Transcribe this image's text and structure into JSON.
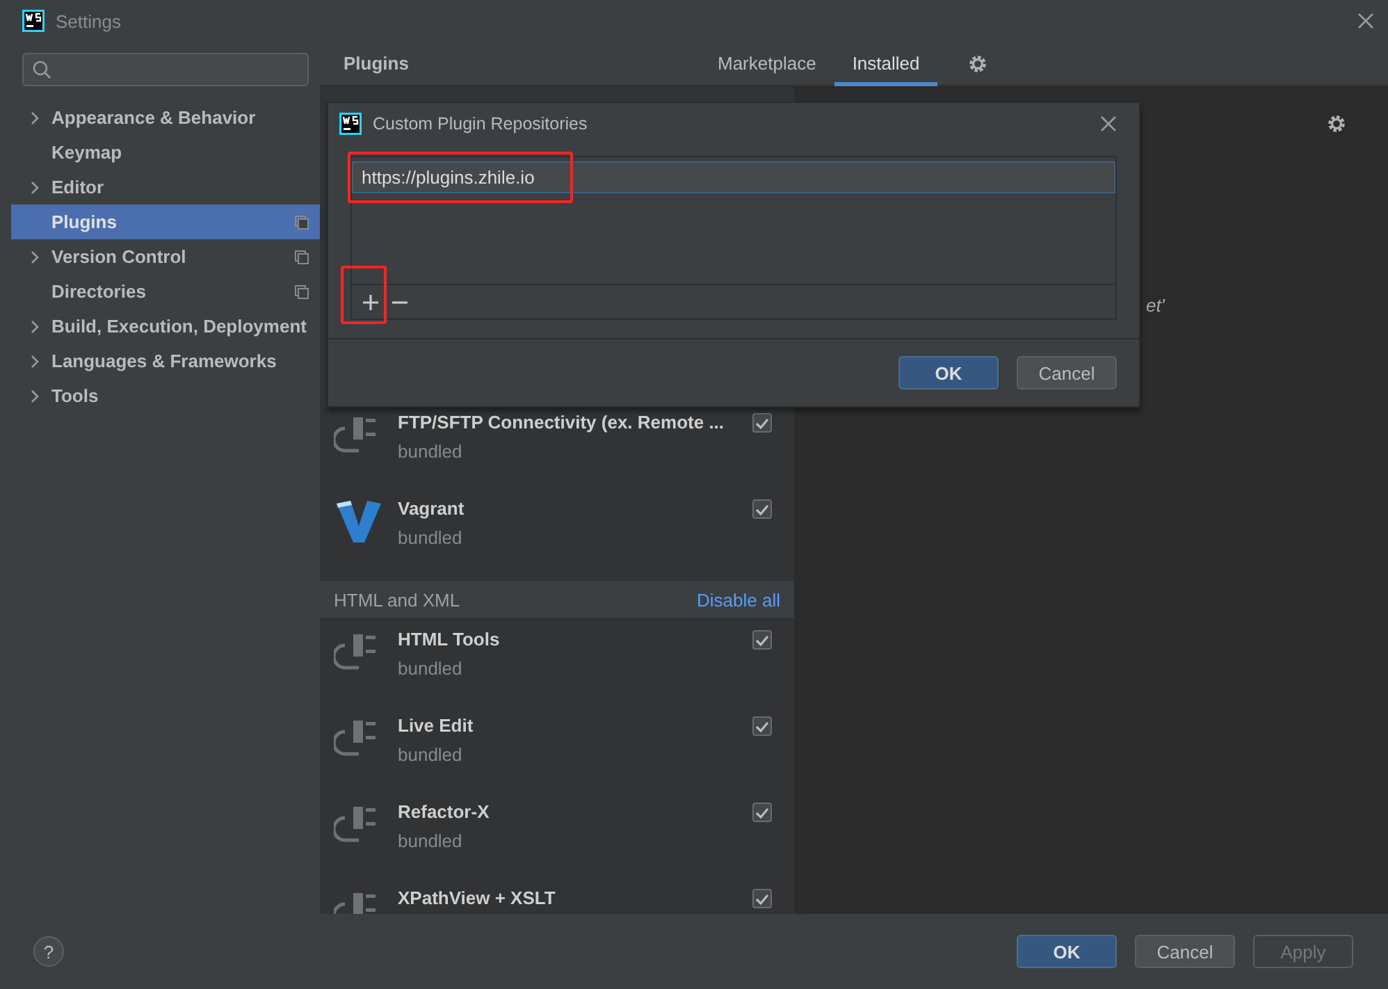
{
  "window": {
    "title": "Settings"
  },
  "sidebar": {
    "items": [
      {
        "label": "Appearance & Behavior",
        "expandable": true,
        "selected": false,
        "project_level": false
      },
      {
        "label": "Keymap",
        "expandable": false,
        "selected": false,
        "project_level": false
      },
      {
        "label": "Editor",
        "expandable": true,
        "selected": false,
        "project_level": false
      },
      {
        "label": "Plugins",
        "expandable": false,
        "selected": true,
        "project_level": true
      },
      {
        "label": "Version Control",
        "expandable": true,
        "selected": false,
        "project_level": true
      },
      {
        "label": "Directories",
        "expandable": false,
        "selected": false,
        "project_level": true
      },
      {
        "label": "Build, Execution, Deployment",
        "expandable": true,
        "selected": false,
        "project_level": false
      },
      {
        "label": "Languages & Frameworks",
        "expandable": true,
        "selected": false,
        "project_level": false
      },
      {
        "label": "Tools",
        "expandable": true,
        "selected": false,
        "project_level": false
      }
    ]
  },
  "header": {
    "title": "Plugins",
    "tabs": [
      {
        "label": "Marketplace",
        "selected": false
      },
      {
        "label": "Installed",
        "selected": true
      }
    ]
  },
  "plugins": [
    {
      "kind": "plugin",
      "name": "FTP/SFTP Connectivity (ex. Remote ...",
      "status": "bundled",
      "checked": true
    },
    {
      "kind": "vagrant",
      "name": "Vagrant",
      "status": "bundled",
      "checked": true
    },
    {
      "kind": "section",
      "name": "HTML and XML",
      "action": "Disable all"
    },
    {
      "kind": "plugin",
      "name": "HTML Tools",
      "status": "bundled",
      "checked": true
    },
    {
      "kind": "plugin",
      "name": "Live Edit",
      "status": "bundled",
      "checked": true
    },
    {
      "kind": "plugin",
      "name": "Refactor-X",
      "status": "bundled",
      "checked": true
    },
    {
      "kind": "plugin",
      "name": "XPathView + XSLT",
      "checked": true
    }
  ],
  "detail": {
    "fragment": "et'"
  },
  "dialog": {
    "title": "Custom Plugin Repositories",
    "repositories": [
      {
        "url": "https://plugins.zhile.io",
        "selected": true,
        "highlighted": true
      }
    ],
    "add_highlighted": true,
    "buttons": [
      {
        "label": "OK",
        "kind": "primary"
      },
      {
        "label": "Cancel",
        "kind": "secondary"
      }
    ]
  },
  "footer": {
    "help": "?",
    "buttons": [
      {
        "label": "OK",
        "kind": "primary",
        "disabled": false
      },
      {
        "label": "Cancel",
        "kind": "secondary",
        "disabled": false
      },
      {
        "label": "Apply",
        "kind": "secondary",
        "disabled": true
      }
    ]
  }
}
